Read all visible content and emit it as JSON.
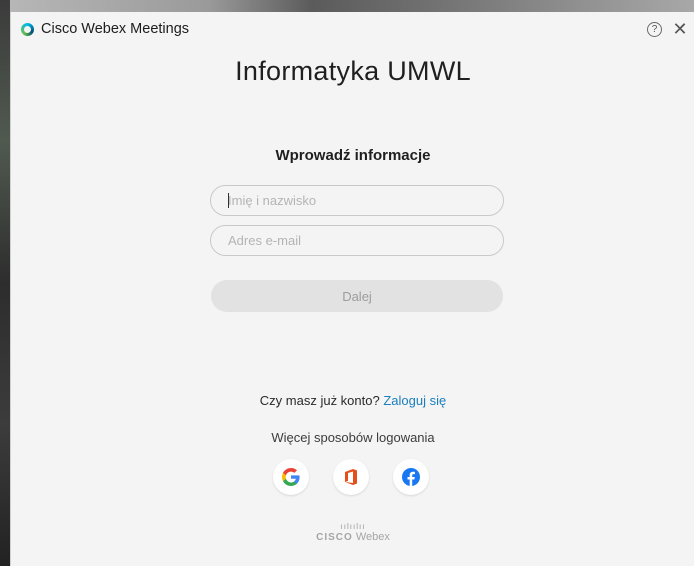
{
  "window": {
    "app_title": "Cisco Webex Meetings",
    "help_glyph": "?",
    "close_glyph": "✕"
  },
  "site": {
    "title": "Informatyka UMWL"
  },
  "form": {
    "heading": "Wprowadź informacje",
    "name_placeholder": "Imię i nazwisko",
    "email_placeholder": "Adres e-mail",
    "next_label": "Dalej"
  },
  "login": {
    "question": "Czy masz już konto?",
    "link": "Zaloguj się",
    "more_ways": "Więcej sposobów logowania"
  },
  "social_icons": [
    "google-icon",
    "office-icon",
    "facebook-icon"
  ],
  "footer": {
    "brand_bars": "ıılıılıı",
    "cisco": "CISCO",
    "webex": "Webex"
  },
  "colors": {
    "link": "#1a7fbd",
    "office": "#e74c1b",
    "facebook": "#1877f2"
  }
}
